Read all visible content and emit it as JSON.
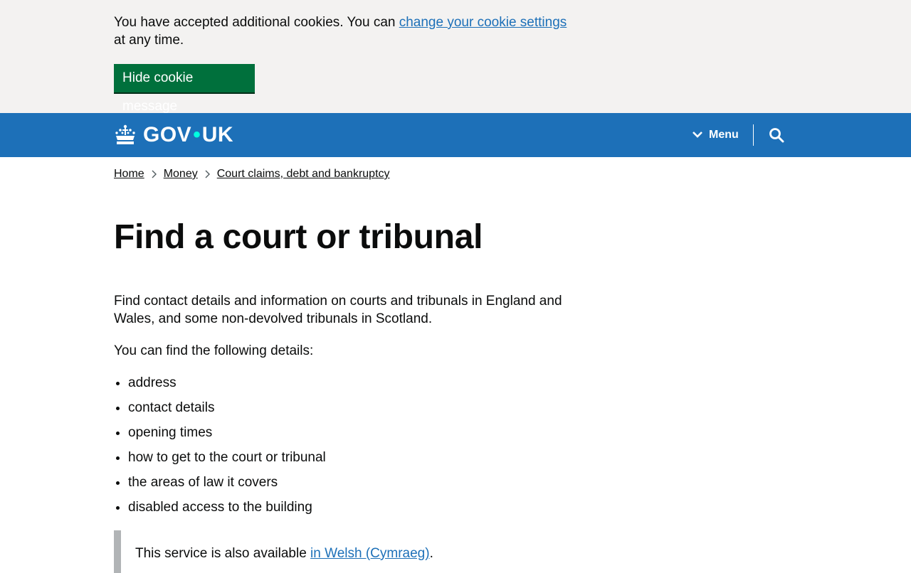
{
  "cookie_banner": {
    "text_before": "You have accepted additional cookies. You can ",
    "link": "change your cookie settings",
    "text_after": " at any time.",
    "button": "Hide cookie message"
  },
  "header": {
    "logo_left": "GOV",
    "logo_dot": "•",
    "logo_right": "UK",
    "menu_label": "Menu"
  },
  "breadcrumbs": [
    "Home",
    "Money",
    "Court claims, debt and bankruptcy"
  ],
  "main": {
    "title": "Find a court or tribunal",
    "intro": "Find contact details and information on courts and tribunals in England and Wales, and some non-devolved tribunals in Scotland.",
    "lead": "You can find the following details:",
    "list": [
      "address",
      "contact details",
      "opening times",
      "how to get to the court or tribunal",
      "the areas of law it covers",
      "disabled access to the building"
    ],
    "inset_before": "This service is also available ",
    "inset_link": "in Welsh (Cymraeg)",
    "inset_after": "."
  },
  "icons": {
    "crown": "crown-icon",
    "menu": "chevron-down-icon",
    "search": "search-icon",
    "breadcrumb_separator": "chevron-right-icon"
  },
  "colors": {
    "header": "#1d70b8",
    "cookie_bg": "#f3f2f1",
    "button": "#00703c",
    "link": "#1d70b8",
    "logo_dot": "#00ffe0",
    "inset_border": "#b1b4b6"
  }
}
